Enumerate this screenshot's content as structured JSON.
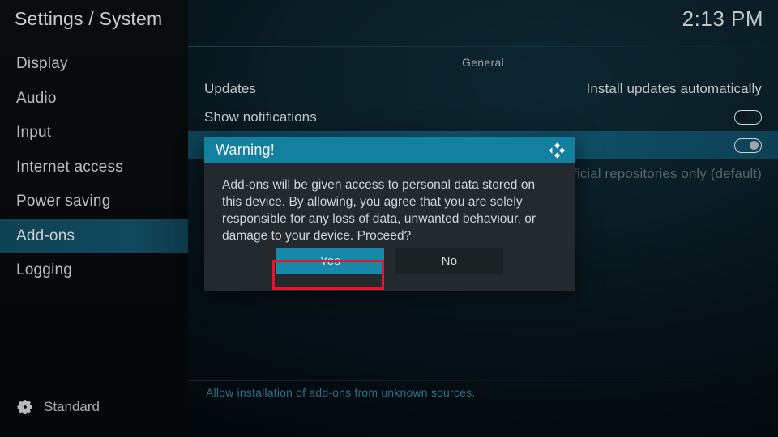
{
  "header": {
    "title": "Settings / System",
    "clock": "2:13 PM"
  },
  "sidebar": {
    "items": [
      {
        "label": "Display",
        "selected": false
      },
      {
        "label": "Audio",
        "selected": false
      },
      {
        "label": "Input",
        "selected": false
      },
      {
        "label": "Internet access",
        "selected": false
      },
      {
        "label": "Power saving",
        "selected": false
      },
      {
        "label": "Add-ons",
        "selected": true
      },
      {
        "label": "Logging",
        "selected": false
      }
    ],
    "footer": {
      "icon": "gear-icon",
      "label": "Standard"
    }
  },
  "content": {
    "group_title": "General",
    "rows": [
      {
        "label": "Updates",
        "value": "Install updates automatically",
        "control": "text",
        "state": "",
        "focused": false,
        "dim": false
      },
      {
        "label": "Show notifications",
        "value": "",
        "control": "toggle",
        "state": "off",
        "focused": false,
        "dim": false
      },
      {
        "label": "",
        "value": "",
        "control": "toggle",
        "state": "on",
        "focused": true,
        "dim": false
      },
      {
        "label": "",
        "value": "Official repositories only (default)",
        "control": "text",
        "state": "",
        "focused": false,
        "dim": true
      }
    ],
    "description": "Allow installation of add-ons from unknown sources."
  },
  "dialog": {
    "title": "Warning!",
    "logo": "kodi-logo",
    "message": "Add-ons will be given access to personal data stored on this device. By allowing, you agree that you are solely responsible for any loss of data, unwanted behaviour, or damage to your device. Proceed?",
    "buttons": [
      {
        "label": "Yes",
        "style": "primary",
        "focused": true
      },
      {
        "label": "No",
        "style": "secondary",
        "focused": false
      }
    ]
  },
  "colors": {
    "accent_teal": "#14809f",
    "button_teal": "#1788a8",
    "focus_red": "#e8142d",
    "row_highlight": "#10576f",
    "dialog_body": "#23292c",
    "desc_text": "#2f6f84"
  }
}
